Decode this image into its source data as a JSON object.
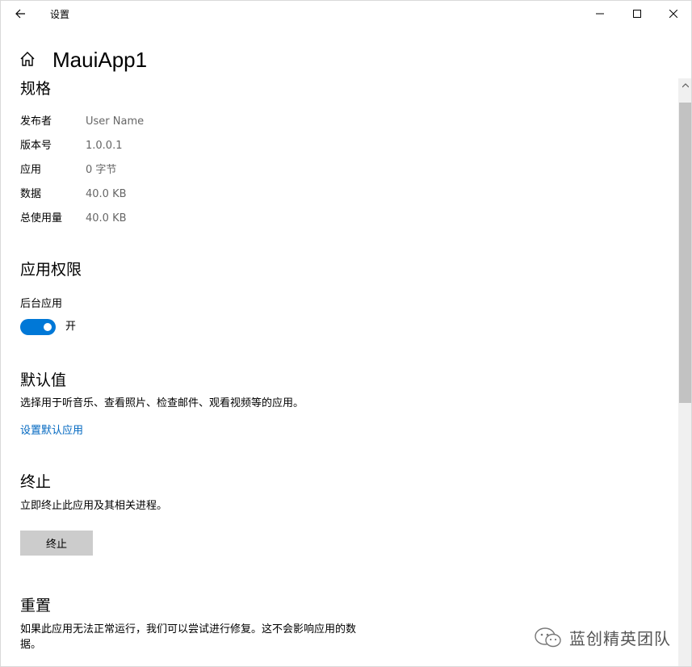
{
  "window": {
    "title": "设置"
  },
  "header": {
    "app_name": "MauiApp1"
  },
  "specs": {
    "title": "规格",
    "rows": [
      {
        "label": "发布者",
        "value": "User Name"
      },
      {
        "label": "版本号",
        "value": "1.0.0.1"
      },
      {
        "label": "应用",
        "value": "0 字节"
      },
      {
        "label": "数据",
        "value": "40.0 KB"
      },
      {
        "label": "总使用量",
        "value": "40.0 KB"
      }
    ]
  },
  "permissions": {
    "title": "应用权限",
    "background_label": "后台应用",
    "toggle_state": "开"
  },
  "defaults": {
    "title": "默认值",
    "description": "选择用于听音乐、查看照片、检查邮件、观看视频等的应用。",
    "link": "设置默认应用"
  },
  "terminate": {
    "title": "终止",
    "description": "立即终止此应用及其相关进程。",
    "button": "终止"
  },
  "reset": {
    "title": "重置",
    "description_line1": "如果此应用无法正常运行，我们可以尝试进行修复。这不会影响应用的数",
    "description_line2": "据。"
  },
  "watermark": {
    "text": "蓝创精英团队"
  },
  "colors": {
    "accent": "#0078d7",
    "link": "#0067c0",
    "button_bg": "#cccccc"
  }
}
